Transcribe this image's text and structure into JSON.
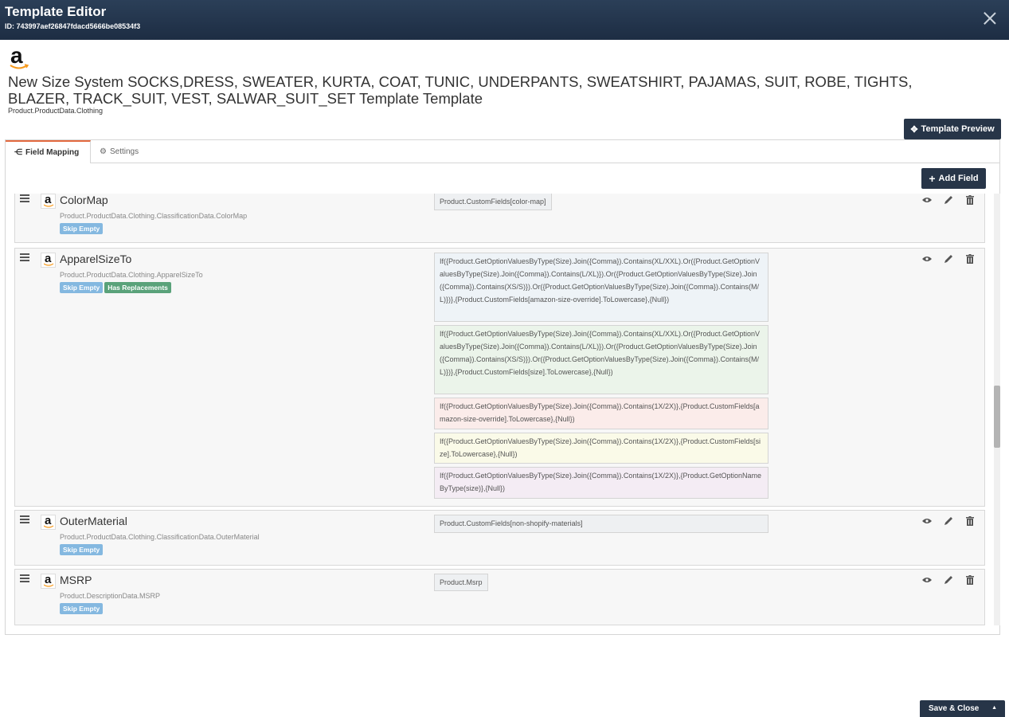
{
  "header": {
    "title": "Template Editor",
    "id_text": "ID: 743997aef26847fdacd5666be08534f3"
  },
  "template": {
    "heading": "New Size System SOCKS,DRESS, SWEATER, KURTA, COAT, TUNIC, UNDERPANTS, SWEATSHIRT, PAJAMAS, SUIT, ROBE, TIGHTS, BLAZER, TRACK_SUIT, VEST, SALWAR_SUIT_SET Template Template",
    "path": "Product.ProductData.Clothing"
  },
  "toolbar": {
    "preview_label": "Template Preview",
    "add_field_label": "Add Field"
  },
  "tabs": [
    {
      "label": "Field Mapping",
      "active": true
    },
    {
      "label": "Settings",
      "active": false
    }
  ],
  "fields": [
    {
      "name": "ColorMap",
      "path": "Product.ProductData.Clothing.ClassificationData.ColorMap",
      "badges": [
        "Skip Empty"
      ],
      "expressions": [
        "Product.CustomFields[color-map]"
      ]
    },
    {
      "name": "ApparelSizeTo",
      "path": "Product.ProductData.Clothing.ApparelSizeTo",
      "badges": [
        "Skip Empty",
        "Has Replacements"
      ],
      "expressions": [
        "If({Product.GetOptionValuesByType(Size).Join({Comma}).Contains(XL/XXL).Or({Product.GetOptionValuesByType(Size).Join({Comma}).Contains(L/XL)}).Or({Product.GetOptionValuesByType(Size).Join({Comma}).Contains(XS/S)}).Or({Product.GetOptionValuesByType(Size).Join({Comma}).Contains(M/L)})},{Product.CustomFields[amazon-size-override].ToLowercase},{Null})",
        "If({Product.GetOptionValuesByType(Size).Join({Comma}).Contains(XL/XXL).Or({Product.GetOptionValuesByType(Size).Join({Comma}).Contains(L/XL)}).Or({Product.GetOptionValuesByType(Size).Join({Comma}).Contains(XS/S)}).Or({Product.GetOptionValuesByType(Size).Join({Comma}).Contains(M/L)})},{Product.CustomFields[size].ToLowercase},{Null})",
        "If({Product.GetOptionValuesByType(Size).Join({Comma}).Contains(1X/2X)},{Product.CustomFields[amazon-size-override].ToLowercase},{Null})",
        "If({Product.GetOptionValuesByType(Size).Join({Comma}).Contains(1X/2X)},{Product.CustomFields[size].ToLowercase},{Null})",
        "If({Product.GetOptionValuesByType(Size).Join({Comma}).Contains(1X/2X)},{Product.GetOptionNameByType(size)},{Null})"
      ]
    },
    {
      "name": "OuterMaterial",
      "path": "Product.ProductData.Clothing.ClassificationData.OuterMaterial",
      "badges": [
        "Skip Empty"
      ],
      "expressions": [
        "Product.CustomFields[non-shopify-materials]"
      ]
    },
    {
      "name": "MSRP",
      "path": "Product.DescriptionData.MSRP",
      "badges": [
        "Skip Empty"
      ],
      "expressions": [
        "Product.Msrp"
      ]
    }
  ],
  "footer": {
    "save_label": "Save & Close"
  },
  "colors": {
    "header_bg": "#1f2f45",
    "button_bg": "#273548",
    "tab_accent": "#e36a3f",
    "skip_badge": "#84b8e0",
    "replacement_badge": "#5aa27a"
  },
  "icons": [
    "close-icon",
    "amazon-logo",
    "template-preview-icon",
    "field-mapping-icon",
    "gear-icon",
    "plus-icon",
    "drag-handle-icon",
    "eye-icon",
    "pencil-icon",
    "trash-icon",
    "caret-up-icon"
  ]
}
